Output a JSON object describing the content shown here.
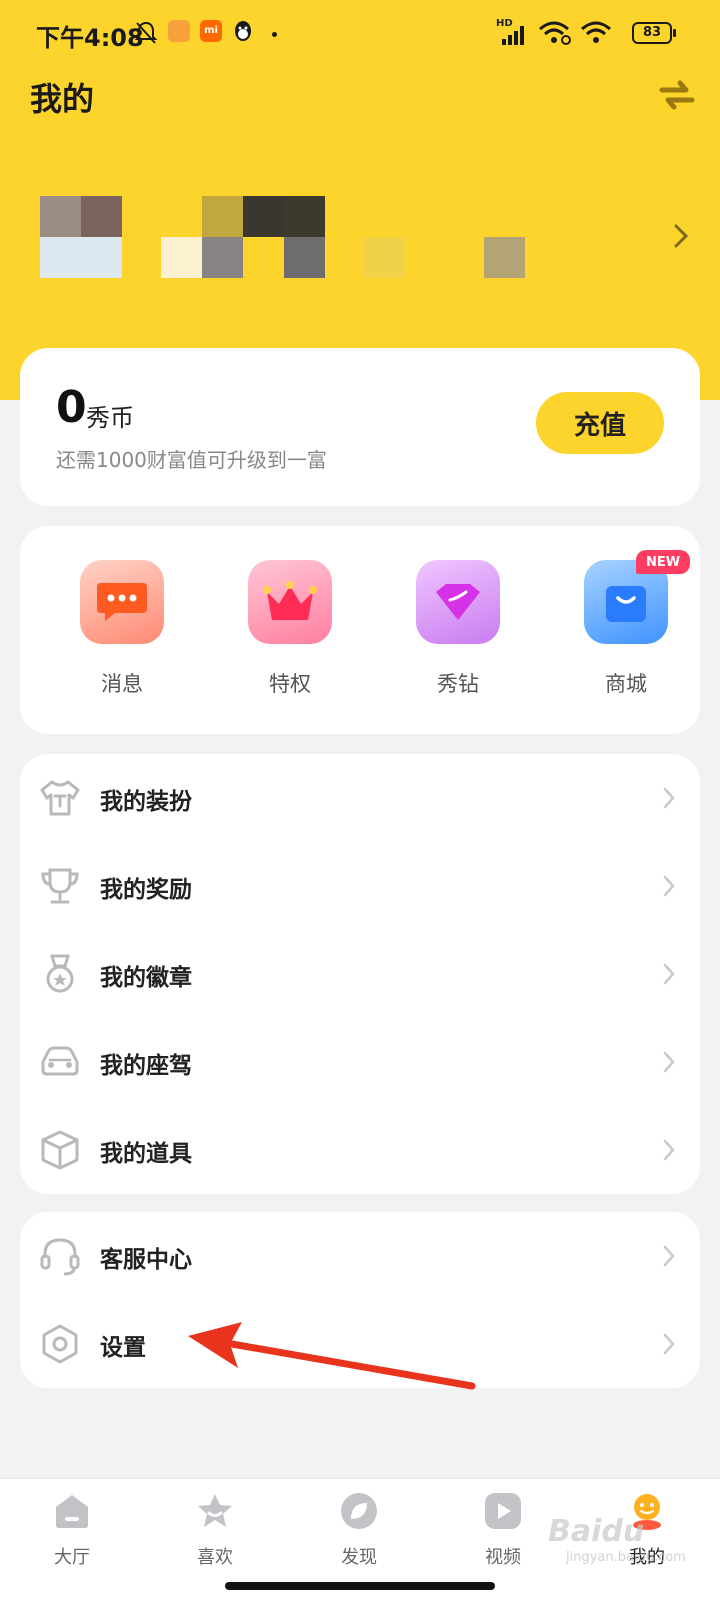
{
  "status_bar": {
    "time": "下午4:08",
    "network": "HD",
    "battery": "83"
  },
  "header": {
    "title": "我的",
    "switch_icon": "swap-arrows-icon"
  },
  "profile": {
    "chevron_icon": "chevron-right-icon"
  },
  "coins": {
    "value": "0",
    "unit": "秀币",
    "hint": "还需1000财富值可升级到一富",
    "recharge_label": "充值"
  },
  "quick_grid": [
    {
      "label": "消息",
      "icon": "chat-bubble-icon",
      "color": "#ff5a3c"
    },
    {
      "label": "特权",
      "icon": "crown-icon",
      "color": "#ff4f7a"
    },
    {
      "label": "秀钻",
      "icon": "diamond-icon",
      "color": "#c44fe6"
    },
    {
      "label": "商城",
      "icon": "shopping-bag-icon",
      "color": "#2f8cff",
      "badge": "NEW"
    }
  ],
  "menu_primary": [
    {
      "label": "我的装扮",
      "icon": "tshirt-icon"
    },
    {
      "label": "我的奖励",
      "icon": "trophy-icon"
    },
    {
      "label": "我的徽章",
      "icon": "medal-icon"
    },
    {
      "label": "我的座驾",
      "icon": "car-icon"
    },
    {
      "label": "我的道具",
      "icon": "box-icon"
    }
  ],
  "menu_secondary": [
    {
      "label": "客服中心",
      "icon": "headset-icon"
    },
    {
      "label": "设置",
      "icon": "settings-hexagon-icon"
    }
  ],
  "bottom_nav": [
    {
      "label": "大厅",
      "icon": "house-icon"
    },
    {
      "label": "喜欢",
      "icon": "star-icon"
    },
    {
      "label": "发现",
      "icon": "compass-leaf-icon"
    },
    {
      "label": "视频",
      "icon": "play-icon"
    },
    {
      "label": "我的",
      "icon": "profile-mascot-icon",
      "active": true
    }
  ],
  "watermark": {
    "text": "Baidu",
    "sub": "jingyan.baidu.com"
  },
  "colors": {
    "brand_yellow": "#fdd42b",
    "background": "#f2f2f4",
    "annotation_red": "#e8341c"
  }
}
